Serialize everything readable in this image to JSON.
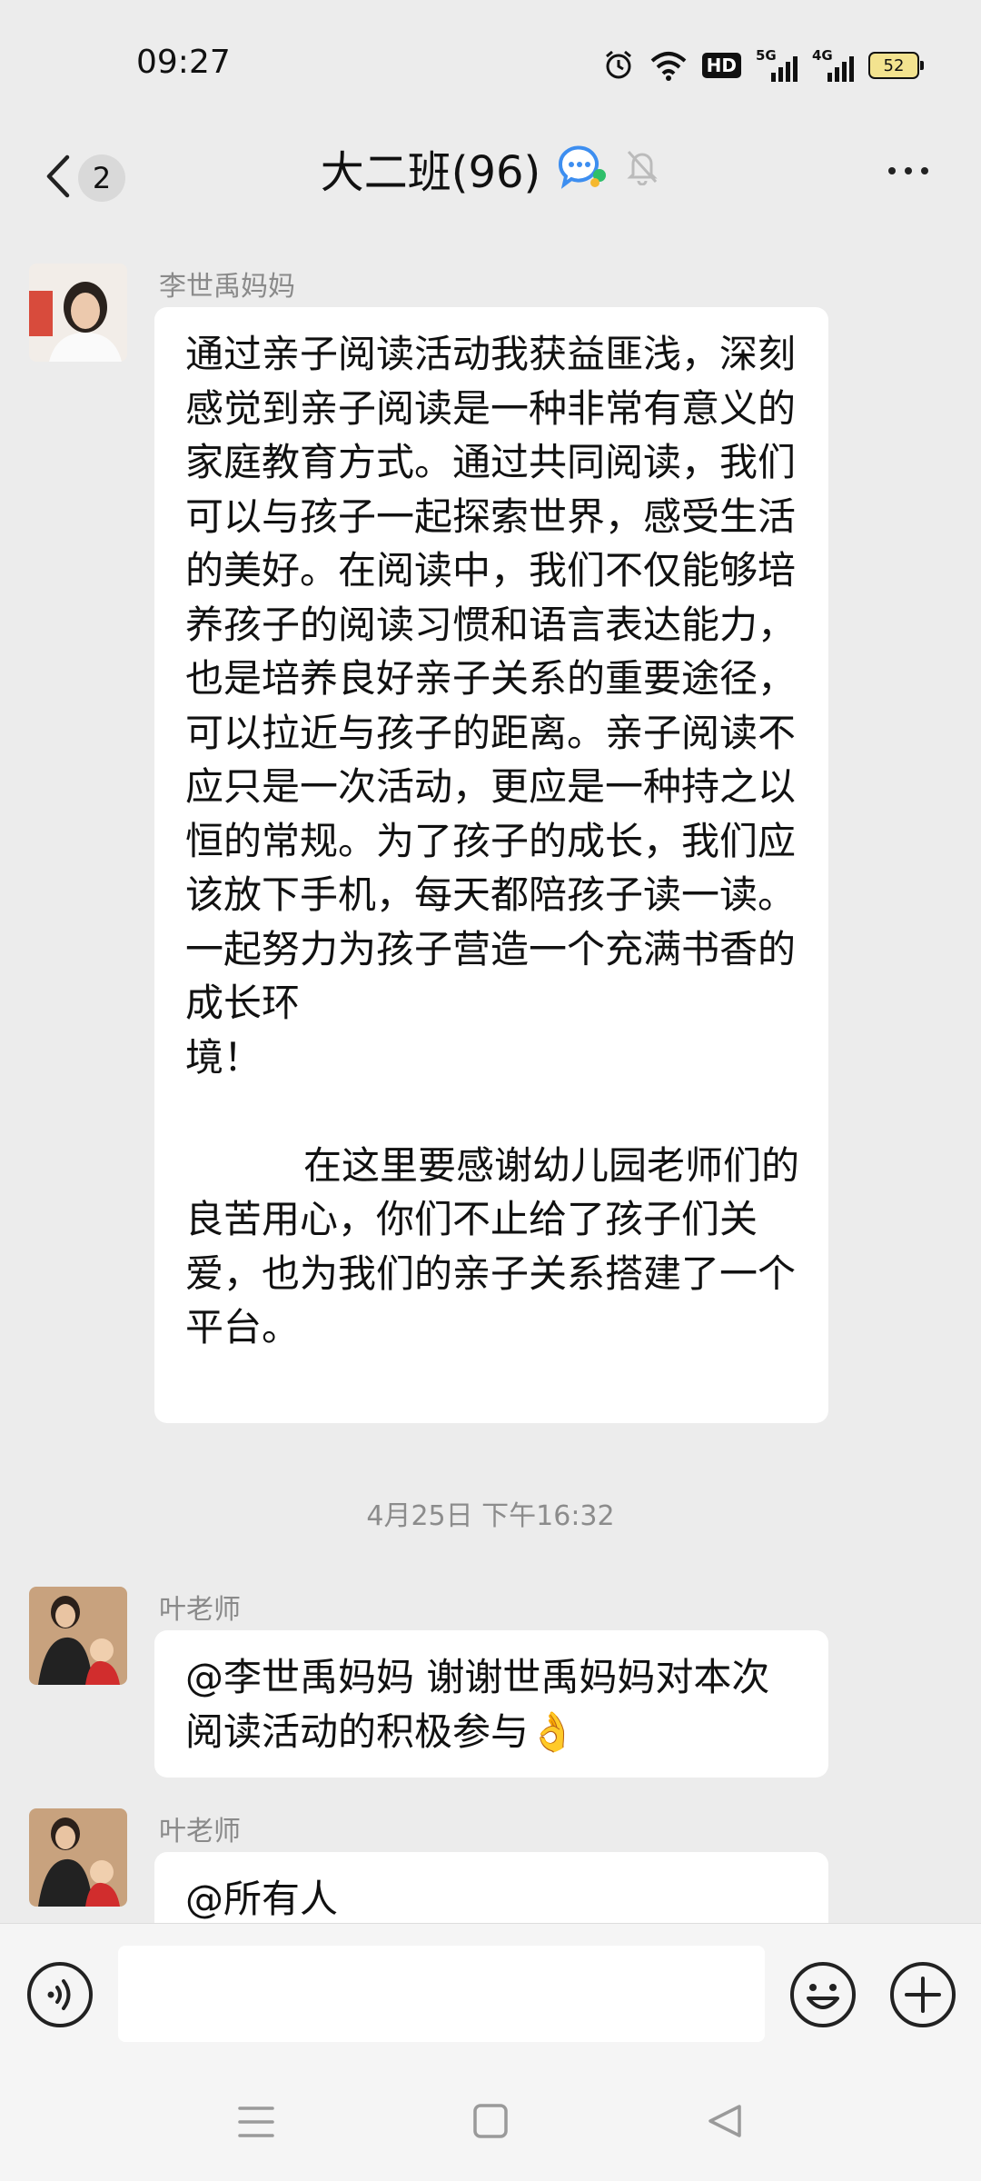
{
  "status_bar": {
    "time": "09:27",
    "hd_label": "HD",
    "network_1": "5G",
    "network_2": "4G",
    "battery": "52"
  },
  "header": {
    "unread_count": "2",
    "title": "大二班(96)"
  },
  "messages": [
    {
      "sender": "李世禹妈妈",
      "paragraphs": [
        "通过亲子阅读活动我获益匪浅，深刻感觉到亲子阅读是一种非常有意义的家庭教育方式。通过共同阅读，我们可以与孩子一起探索世界，感受生活的美好。在阅读中，我们不仅能够培养孩子的阅读习惯和语言表达能力，也是培养良好亲子关系的重要途径，可以拉近与孩子的距离。亲子阅读不应只是一次活动，更应是一种持之以恒的常规。为了孩子的成长，我们应该放下手机，每天都陪孩子读一读。一起努力为孩子营造一个充满书香的成长环",
        "境！",
        "",
        "在这里要感谢幼儿园老师们的良苦用心，你们不止给了孩子们关爱，也为我们的亲子关系搭建了一个平台。"
      ]
    },
    {
      "sender": "叶老师",
      "text": "@李世禹妈妈  谢谢世禹妈妈对本次阅读活动的积极参与👌"
    },
    {
      "sender": "叶老师",
      "text": "@所有人"
    }
  ],
  "timestamp": "4月25日 下午16:32",
  "input": {
    "placeholder": ""
  },
  "icons": {
    "alarm": "alarm-icon",
    "wifi": "wifi-icon",
    "voice": "voice-icon",
    "emoji": "emoji-icon",
    "plus": "plus-icon",
    "group_avatar": "group-chat-icon",
    "mute": "muted-bell-icon"
  },
  "colors": {
    "chat_background": "#ececec",
    "bubble": "#ffffff",
    "accent_blue": "#3d8ef0",
    "accent_green": "#2fbf6a"
  }
}
